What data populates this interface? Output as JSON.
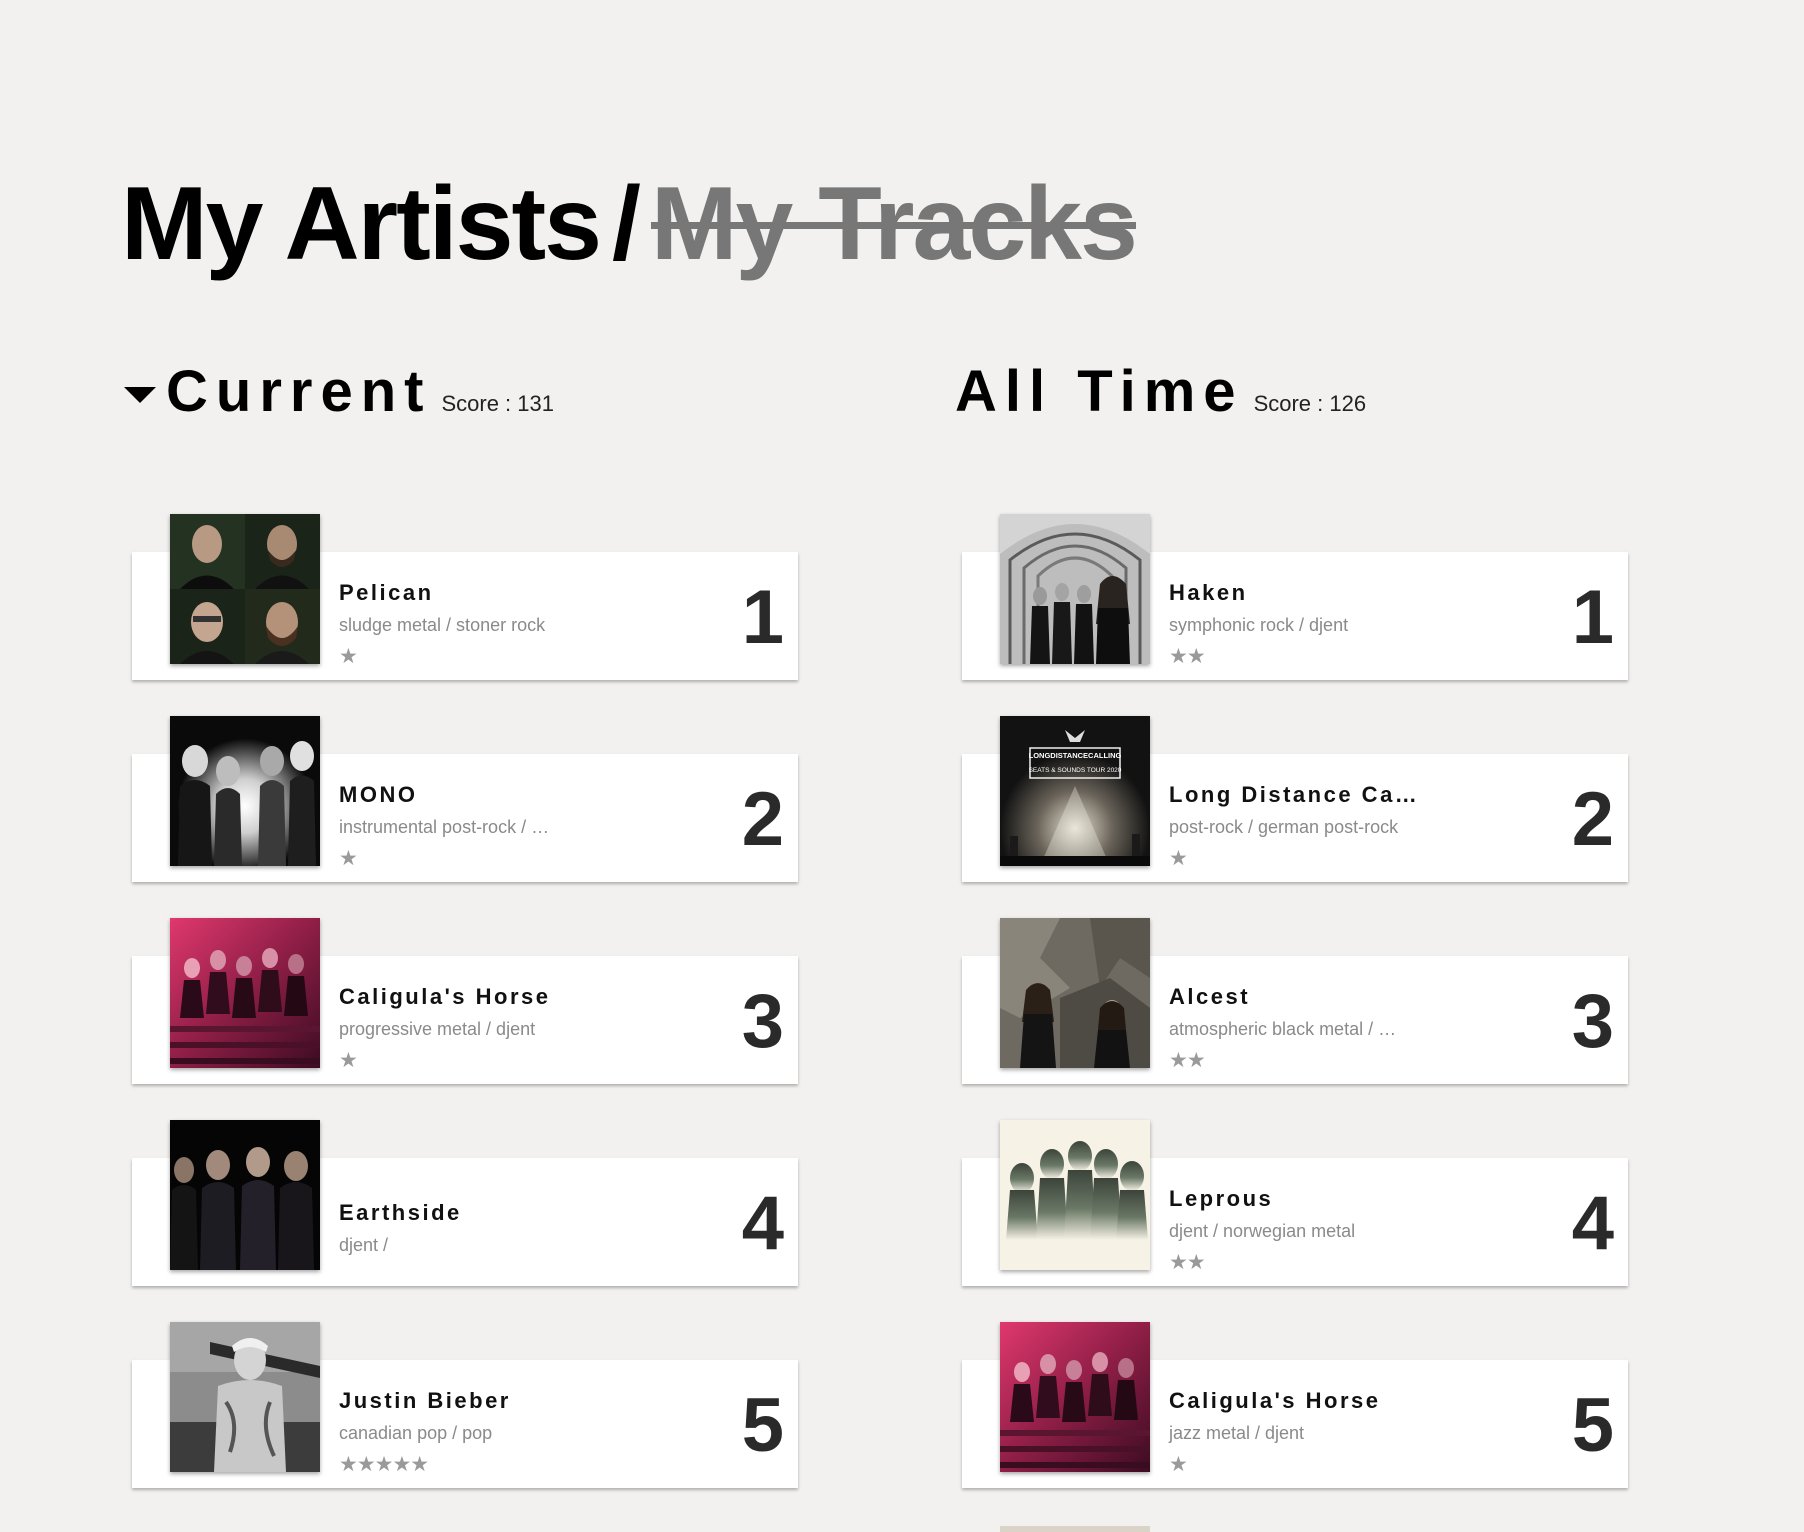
{
  "title": {
    "artists": "My Artists",
    "separator": "/",
    "tracks": "My Tracks"
  },
  "current": {
    "title": "Current",
    "score": "Score : 131",
    "items": [
      {
        "name": "Pelican",
        "genre": "sludge metal / stoner rock",
        "stars": "★",
        "rank": "1"
      },
      {
        "name": "MONO",
        "genre": "instrumental post-rock / …",
        "stars": "★",
        "rank": "2"
      },
      {
        "name": "Caligula's Horse",
        "genre": "progressive metal / djent",
        "stars": "★",
        "rank": "3"
      },
      {
        "name": "Earthside",
        "genre": "djent /",
        "stars": "",
        "rank": "4"
      },
      {
        "name": "Justin Bieber",
        "genre": "canadian pop / pop",
        "stars": "★★★★★",
        "rank": "5"
      }
    ]
  },
  "alltime": {
    "title": "All Time",
    "score": "Score : 126",
    "items": [
      {
        "name": "Haken",
        "genre": "symphonic rock / djent",
        "stars": "★★",
        "rank": "1"
      },
      {
        "name": "Long Distance Ca…",
        "genre": "post-rock / german post-rock",
        "stars": "★",
        "rank": "2",
        "poster_line1": "LONGDISTANCECALLING",
        "poster_line2": "SEATS & SOUNDS TOUR 2020"
      },
      {
        "name": "Alcest",
        "genre": "atmospheric black metal / …",
        "stars": "★★",
        "rank": "3"
      },
      {
        "name": "Leprous",
        "genre": "djent / norwegian metal",
        "stars": "★★",
        "rank": "4"
      },
      {
        "name": "Caligula's Horse",
        "genre": "jazz metal / djent",
        "stars": "★",
        "rank": "5"
      }
    ]
  },
  "colors": {
    "background": "#f2f1ef",
    "card": "#ffffff",
    "muted_text": "#8a8a8a",
    "strikethrough": "#777777"
  }
}
